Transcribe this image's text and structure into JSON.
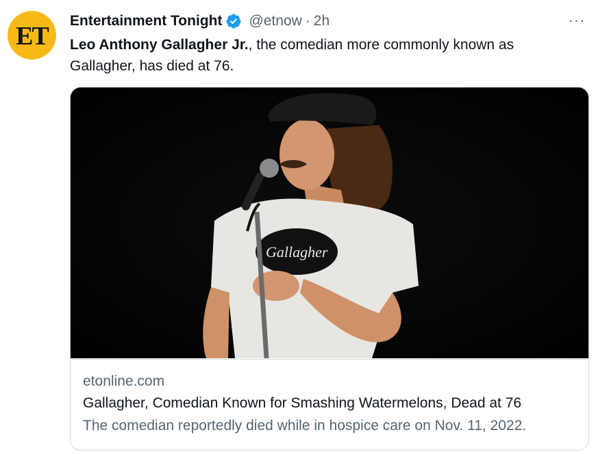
{
  "tweet": {
    "author": {
      "name": "Entertainment Tonight",
      "handle": "@etnow",
      "avatar_initials": "ET",
      "avatar_color": "#f6b917",
      "verified": true,
      "verified_color": "#1d9bf0"
    },
    "separator": "·",
    "time": "2h",
    "more_icon": "more-horizontal-icon",
    "more_glyph": "···",
    "text_bold": "Leo Anthony Gallagher Jr.",
    "text_rest": ", the comedian more commonly known as Gallagher, has died at 76.",
    "card": {
      "image_label": "Gallagher",
      "domain": "etonline.com",
      "title": "Gallagher, Comedian Known for Smashing Watermelons, Dead at 76",
      "description": "The comedian reportedly died while in hospice care on Nov. 11, 2022."
    }
  },
  "colors": {
    "text_primary": "#0f1419",
    "text_secondary": "#536471",
    "border": "#cfd9de"
  }
}
